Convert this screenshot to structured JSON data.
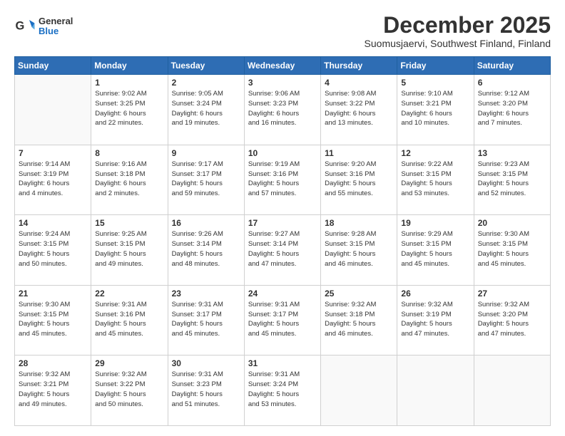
{
  "header": {
    "logo": {
      "general": "General",
      "blue": "Blue"
    },
    "title": "December 2025",
    "location": "Suomusjaervi, Southwest Finland, Finland"
  },
  "calendar": {
    "days_of_week": [
      "Sunday",
      "Monday",
      "Tuesday",
      "Wednesday",
      "Thursday",
      "Friday",
      "Saturday"
    ],
    "weeks": [
      [
        {
          "day": "",
          "info": ""
        },
        {
          "day": "1",
          "info": "Sunrise: 9:02 AM\nSunset: 3:25 PM\nDaylight: 6 hours\nand 22 minutes."
        },
        {
          "day": "2",
          "info": "Sunrise: 9:05 AM\nSunset: 3:24 PM\nDaylight: 6 hours\nand 19 minutes."
        },
        {
          "day": "3",
          "info": "Sunrise: 9:06 AM\nSunset: 3:23 PM\nDaylight: 6 hours\nand 16 minutes."
        },
        {
          "day": "4",
          "info": "Sunrise: 9:08 AM\nSunset: 3:22 PM\nDaylight: 6 hours\nand 13 minutes."
        },
        {
          "day": "5",
          "info": "Sunrise: 9:10 AM\nSunset: 3:21 PM\nDaylight: 6 hours\nand 10 minutes."
        },
        {
          "day": "6",
          "info": "Sunrise: 9:12 AM\nSunset: 3:20 PM\nDaylight: 6 hours\nand 7 minutes."
        }
      ],
      [
        {
          "day": "7",
          "info": "Sunrise: 9:14 AM\nSunset: 3:19 PM\nDaylight: 6 hours\nand 4 minutes."
        },
        {
          "day": "8",
          "info": "Sunrise: 9:16 AM\nSunset: 3:18 PM\nDaylight: 6 hours\nand 2 minutes."
        },
        {
          "day": "9",
          "info": "Sunrise: 9:17 AM\nSunset: 3:17 PM\nDaylight: 5 hours\nand 59 minutes."
        },
        {
          "day": "10",
          "info": "Sunrise: 9:19 AM\nSunset: 3:16 PM\nDaylight: 5 hours\nand 57 minutes."
        },
        {
          "day": "11",
          "info": "Sunrise: 9:20 AM\nSunset: 3:16 PM\nDaylight: 5 hours\nand 55 minutes."
        },
        {
          "day": "12",
          "info": "Sunrise: 9:22 AM\nSunset: 3:15 PM\nDaylight: 5 hours\nand 53 minutes."
        },
        {
          "day": "13",
          "info": "Sunrise: 9:23 AM\nSunset: 3:15 PM\nDaylight: 5 hours\nand 52 minutes."
        }
      ],
      [
        {
          "day": "14",
          "info": "Sunrise: 9:24 AM\nSunset: 3:15 PM\nDaylight: 5 hours\nand 50 minutes."
        },
        {
          "day": "15",
          "info": "Sunrise: 9:25 AM\nSunset: 3:15 PM\nDaylight: 5 hours\nand 49 minutes."
        },
        {
          "day": "16",
          "info": "Sunrise: 9:26 AM\nSunset: 3:14 PM\nDaylight: 5 hours\nand 48 minutes."
        },
        {
          "day": "17",
          "info": "Sunrise: 9:27 AM\nSunset: 3:14 PM\nDaylight: 5 hours\nand 47 minutes."
        },
        {
          "day": "18",
          "info": "Sunrise: 9:28 AM\nSunset: 3:15 PM\nDaylight: 5 hours\nand 46 minutes."
        },
        {
          "day": "19",
          "info": "Sunrise: 9:29 AM\nSunset: 3:15 PM\nDaylight: 5 hours\nand 45 minutes."
        },
        {
          "day": "20",
          "info": "Sunrise: 9:30 AM\nSunset: 3:15 PM\nDaylight: 5 hours\nand 45 minutes."
        }
      ],
      [
        {
          "day": "21",
          "info": "Sunrise: 9:30 AM\nSunset: 3:15 PM\nDaylight: 5 hours\nand 45 minutes."
        },
        {
          "day": "22",
          "info": "Sunrise: 9:31 AM\nSunset: 3:16 PM\nDaylight: 5 hours\nand 45 minutes."
        },
        {
          "day": "23",
          "info": "Sunrise: 9:31 AM\nSunset: 3:17 PM\nDaylight: 5 hours\nand 45 minutes."
        },
        {
          "day": "24",
          "info": "Sunrise: 9:31 AM\nSunset: 3:17 PM\nDaylight: 5 hours\nand 45 minutes."
        },
        {
          "day": "25",
          "info": "Sunrise: 9:32 AM\nSunset: 3:18 PM\nDaylight: 5 hours\nand 46 minutes."
        },
        {
          "day": "26",
          "info": "Sunrise: 9:32 AM\nSunset: 3:19 PM\nDaylight: 5 hours\nand 47 minutes."
        },
        {
          "day": "27",
          "info": "Sunrise: 9:32 AM\nSunset: 3:20 PM\nDaylight: 5 hours\nand 47 minutes."
        }
      ],
      [
        {
          "day": "28",
          "info": "Sunrise: 9:32 AM\nSunset: 3:21 PM\nDaylight: 5 hours\nand 49 minutes."
        },
        {
          "day": "29",
          "info": "Sunrise: 9:32 AM\nSunset: 3:22 PM\nDaylight: 5 hours\nand 50 minutes."
        },
        {
          "day": "30",
          "info": "Sunrise: 9:31 AM\nSunset: 3:23 PM\nDaylight: 5 hours\nand 51 minutes."
        },
        {
          "day": "31",
          "info": "Sunrise: 9:31 AM\nSunset: 3:24 PM\nDaylight: 5 hours\nand 53 minutes."
        },
        {
          "day": "",
          "info": ""
        },
        {
          "day": "",
          "info": ""
        },
        {
          "day": "",
          "info": ""
        }
      ]
    ]
  }
}
